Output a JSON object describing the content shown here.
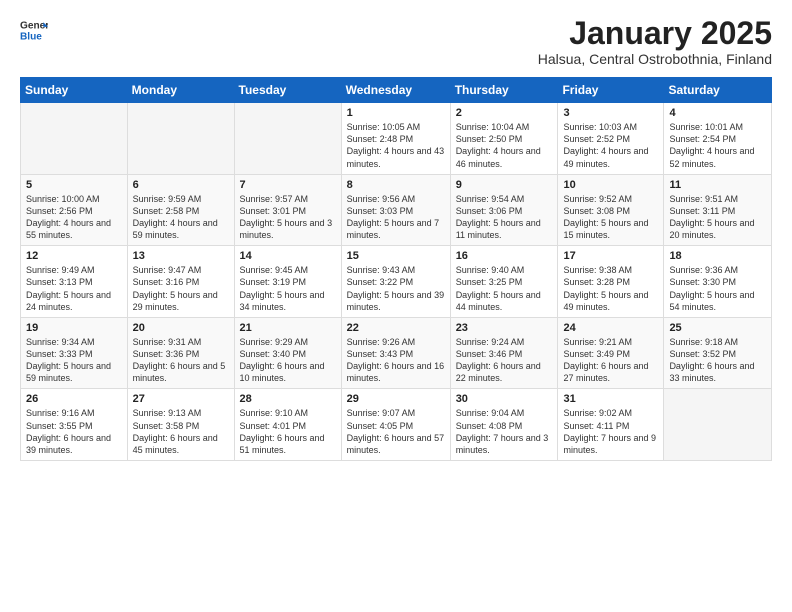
{
  "logo": {
    "general": "General",
    "blue": "Blue"
  },
  "header": {
    "title": "January 2025",
    "subtitle": "Halsua, Central Ostrobothnia, Finland"
  },
  "weekdays": [
    "Sunday",
    "Monday",
    "Tuesday",
    "Wednesday",
    "Thursday",
    "Friday",
    "Saturday"
  ],
  "weeks": [
    [
      {
        "day": "",
        "info": ""
      },
      {
        "day": "",
        "info": ""
      },
      {
        "day": "",
        "info": ""
      },
      {
        "day": "1",
        "info": "Sunrise: 10:05 AM\nSunset: 2:48 PM\nDaylight: 4 hours and 43 minutes."
      },
      {
        "day": "2",
        "info": "Sunrise: 10:04 AM\nSunset: 2:50 PM\nDaylight: 4 hours and 46 minutes."
      },
      {
        "day": "3",
        "info": "Sunrise: 10:03 AM\nSunset: 2:52 PM\nDaylight: 4 hours and 49 minutes."
      },
      {
        "day": "4",
        "info": "Sunrise: 10:01 AM\nSunset: 2:54 PM\nDaylight: 4 hours and 52 minutes."
      }
    ],
    [
      {
        "day": "5",
        "info": "Sunrise: 10:00 AM\nSunset: 2:56 PM\nDaylight: 4 hours and 55 minutes."
      },
      {
        "day": "6",
        "info": "Sunrise: 9:59 AM\nSunset: 2:58 PM\nDaylight: 4 hours and 59 minutes."
      },
      {
        "day": "7",
        "info": "Sunrise: 9:57 AM\nSunset: 3:01 PM\nDaylight: 5 hours and 3 minutes."
      },
      {
        "day": "8",
        "info": "Sunrise: 9:56 AM\nSunset: 3:03 PM\nDaylight: 5 hours and 7 minutes."
      },
      {
        "day": "9",
        "info": "Sunrise: 9:54 AM\nSunset: 3:06 PM\nDaylight: 5 hours and 11 minutes."
      },
      {
        "day": "10",
        "info": "Sunrise: 9:52 AM\nSunset: 3:08 PM\nDaylight: 5 hours and 15 minutes."
      },
      {
        "day": "11",
        "info": "Sunrise: 9:51 AM\nSunset: 3:11 PM\nDaylight: 5 hours and 20 minutes."
      }
    ],
    [
      {
        "day": "12",
        "info": "Sunrise: 9:49 AM\nSunset: 3:13 PM\nDaylight: 5 hours and 24 minutes."
      },
      {
        "day": "13",
        "info": "Sunrise: 9:47 AM\nSunset: 3:16 PM\nDaylight: 5 hours and 29 minutes."
      },
      {
        "day": "14",
        "info": "Sunrise: 9:45 AM\nSunset: 3:19 PM\nDaylight: 5 hours and 34 minutes."
      },
      {
        "day": "15",
        "info": "Sunrise: 9:43 AM\nSunset: 3:22 PM\nDaylight: 5 hours and 39 minutes."
      },
      {
        "day": "16",
        "info": "Sunrise: 9:40 AM\nSunset: 3:25 PM\nDaylight: 5 hours and 44 minutes."
      },
      {
        "day": "17",
        "info": "Sunrise: 9:38 AM\nSunset: 3:28 PM\nDaylight: 5 hours and 49 minutes."
      },
      {
        "day": "18",
        "info": "Sunrise: 9:36 AM\nSunset: 3:30 PM\nDaylight: 5 hours and 54 minutes."
      }
    ],
    [
      {
        "day": "19",
        "info": "Sunrise: 9:34 AM\nSunset: 3:33 PM\nDaylight: 5 hours and 59 minutes."
      },
      {
        "day": "20",
        "info": "Sunrise: 9:31 AM\nSunset: 3:36 PM\nDaylight: 6 hours and 5 minutes."
      },
      {
        "day": "21",
        "info": "Sunrise: 9:29 AM\nSunset: 3:40 PM\nDaylight: 6 hours and 10 minutes."
      },
      {
        "day": "22",
        "info": "Sunrise: 9:26 AM\nSunset: 3:43 PM\nDaylight: 6 hours and 16 minutes."
      },
      {
        "day": "23",
        "info": "Sunrise: 9:24 AM\nSunset: 3:46 PM\nDaylight: 6 hours and 22 minutes."
      },
      {
        "day": "24",
        "info": "Sunrise: 9:21 AM\nSunset: 3:49 PM\nDaylight: 6 hours and 27 minutes."
      },
      {
        "day": "25",
        "info": "Sunrise: 9:18 AM\nSunset: 3:52 PM\nDaylight: 6 hours and 33 minutes."
      }
    ],
    [
      {
        "day": "26",
        "info": "Sunrise: 9:16 AM\nSunset: 3:55 PM\nDaylight: 6 hours and 39 minutes."
      },
      {
        "day": "27",
        "info": "Sunrise: 9:13 AM\nSunset: 3:58 PM\nDaylight: 6 hours and 45 minutes."
      },
      {
        "day": "28",
        "info": "Sunrise: 9:10 AM\nSunset: 4:01 PM\nDaylight: 6 hours and 51 minutes."
      },
      {
        "day": "29",
        "info": "Sunrise: 9:07 AM\nSunset: 4:05 PM\nDaylight: 6 hours and 57 minutes."
      },
      {
        "day": "30",
        "info": "Sunrise: 9:04 AM\nSunset: 4:08 PM\nDaylight: 7 hours and 3 minutes."
      },
      {
        "day": "31",
        "info": "Sunrise: 9:02 AM\nSunset: 4:11 PM\nDaylight: 7 hours and 9 minutes."
      },
      {
        "day": "",
        "info": ""
      }
    ]
  ]
}
